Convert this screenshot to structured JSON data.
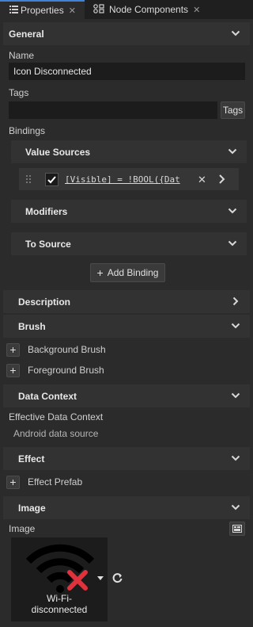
{
  "tabs": [
    {
      "label": "Properties",
      "icon": "list-icon"
    },
    {
      "label": "Node Components",
      "icon": "components-icon"
    }
  ],
  "sections": {
    "general": "General",
    "description": "Description",
    "brush": "Brush",
    "data_context": "Data Context",
    "effect": "Effect",
    "image": "Image"
  },
  "general": {
    "name_label": "Name",
    "name_value": "Icon Disconnected",
    "tags_label": "Tags",
    "tags_button": "Tags",
    "bindings_label": "Bindings"
  },
  "bindings": {
    "value_sources": "Value Sources",
    "binding_expression": "[Visible] = !BOOL({Dat",
    "modifiers": "Modifiers",
    "to_source": "To Source",
    "add_binding": "Add Binding"
  },
  "brush": {
    "background": "Background Brush",
    "foreground": "Foreground Brush"
  },
  "data_context": {
    "label": "Effective Data Context",
    "value": "Android data source"
  },
  "effect": {
    "prefab": "Effect Prefab"
  },
  "image": {
    "label": "Image",
    "caption": "Wi-Fi-\ndisconnected"
  },
  "colors": {
    "background": "#2b2b2b",
    "section": "#323232",
    "field": "#1c1c1c",
    "accent": "#3f82d6",
    "error_red": "#e0323c"
  }
}
